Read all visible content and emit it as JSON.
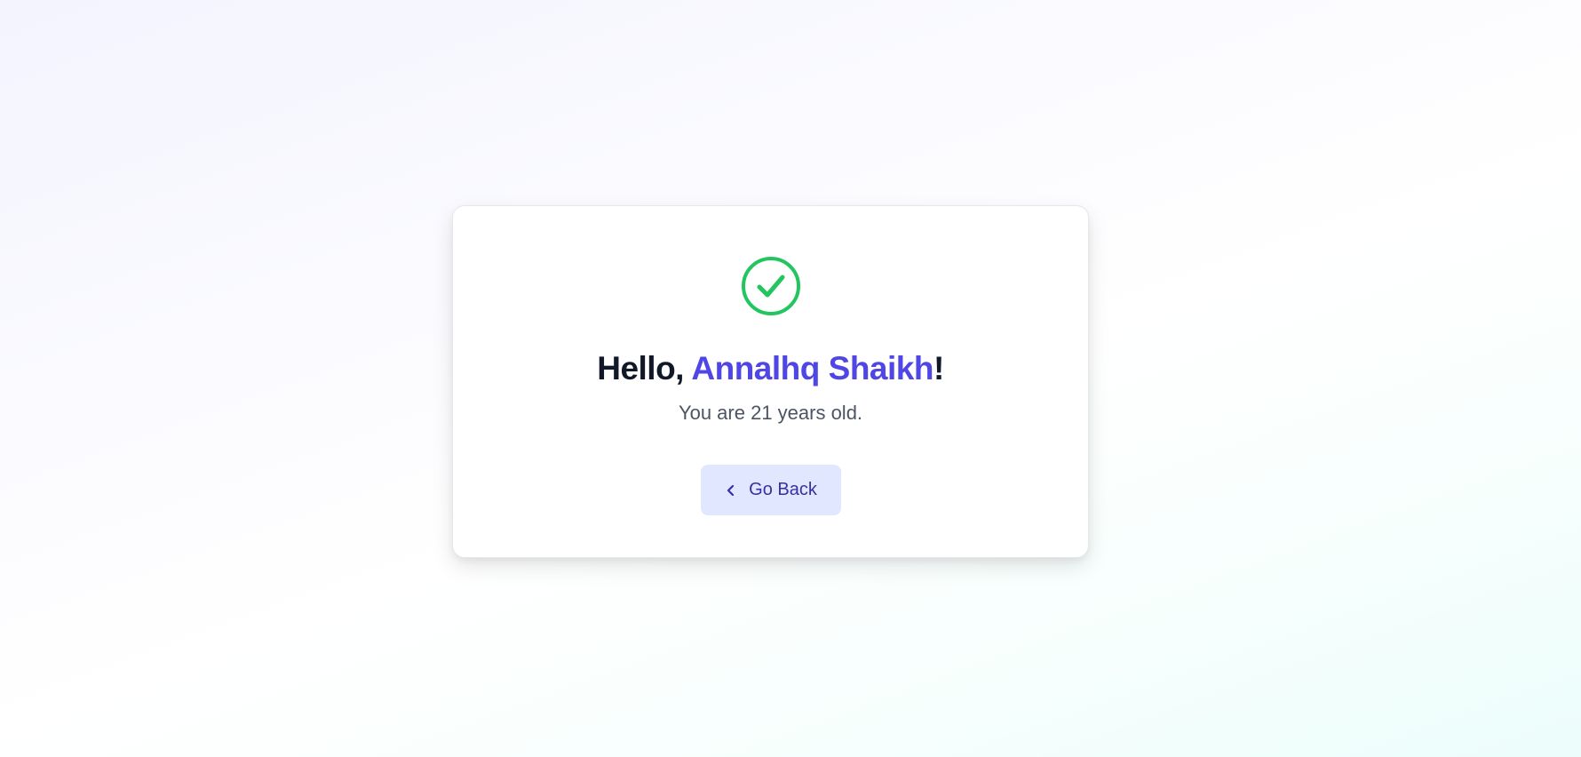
{
  "greeting": {
    "prefix": "Hello, ",
    "name": "Annalhq Shaikh",
    "suffix": "!"
  },
  "age_message": "You are 21 years old.",
  "back_button": {
    "label": "Go Back",
    "icon": "chevron-left-icon"
  },
  "success_icon": "check-circle-icon",
  "colors": {
    "success": "#22c55e",
    "accent": "#4f46e5",
    "button_bg": "#e0e7ff",
    "button_text": "#3730a3",
    "heading": "#111827",
    "body_text": "#4b5563"
  }
}
